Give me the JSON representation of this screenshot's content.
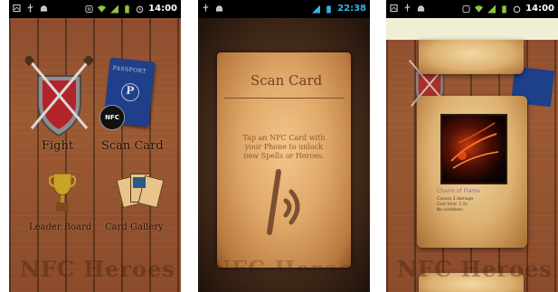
{
  "screen1": {
    "status_time": "14:00",
    "menu": {
      "fight": "Fight",
      "scan_card": "Scan Card",
      "leader_board": "Leader Board",
      "card_gallery": "Card Gallery"
    },
    "passport_label": "PASSPORT",
    "passport_letter": "P",
    "nfc_badge": "NFC",
    "watermark": "NFC Heroes"
  },
  "screen2": {
    "status_time": "22:38",
    "title": "Scan Card",
    "instruction": "Tap an NFC Card with your Phone to unlock new Spells or Heroes.",
    "watermark": "NFC Heroes"
  },
  "screen3": {
    "status_time": "14:00",
    "card_name": "Charm of Flame",
    "card_lines": [
      "Causes 3 damage",
      "Cast time: 1.5s",
      "No cooldown"
    ],
    "watermark": "NFC Heroes"
  },
  "colors": {
    "wood": "#9c5a33",
    "parchment": "#e0a868",
    "statusbar": "#000000",
    "clock_blue": "#33b5e5"
  },
  "icons": [
    "notification-icon",
    "usb-icon",
    "android-icon",
    "nfc-status-icon",
    "wifi-icon",
    "signal-icon",
    "battery-icon",
    "alarm-icon"
  ]
}
